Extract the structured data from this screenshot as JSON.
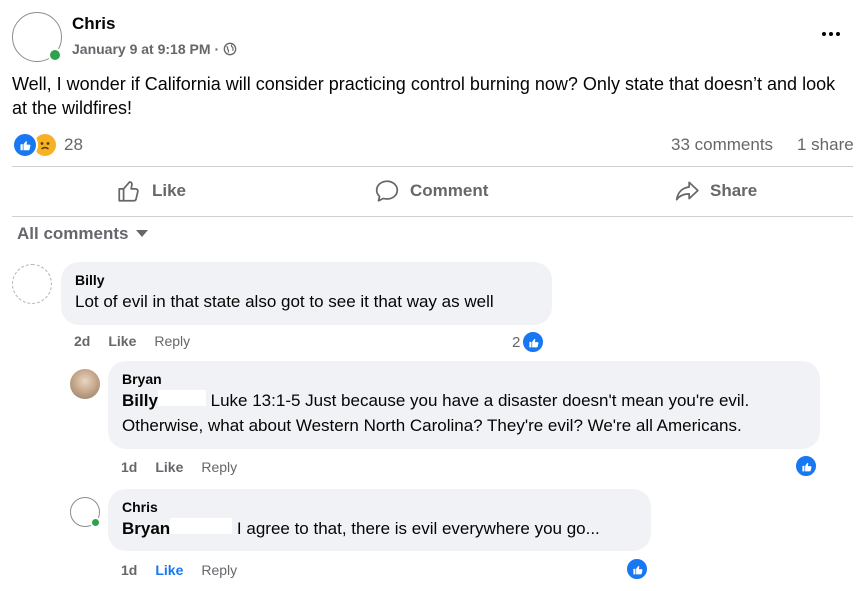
{
  "post": {
    "author": "Chris",
    "date": "January 9 at 9:18 PM",
    "separator": "·",
    "text": "Well, I wonder if California will consider practicing control burning now? Only state that doesn’t and look at the wildfires!",
    "more_icon": "more-dots-icon",
    "privacy_icon": "globe-icon"
  },
  "stats": {
    "reaction_count": "28",
    "comments": "33 comments",
    "shares": "1 share"
  },
  "actions": {
    "like": "Like",
    "comment": "Comment",
    "share": "Share"
  },
  "filter": {
    "label": "All comments"
  },
  "comments": [
    {
      "name": "Billy",
      "text": "Lot of evil in that state also got to see it that way as well",
      "time": "2d",
      "like": "Like",
      "reply": "Reply",
      "like_count": "2"
    },
    {
      "name": "Bryan",
      "mention": "Billy",
      "text_line1": "Luke 13:1-5 Just because you have a disaster doesn't mean you're evil.",
      "text_line2": "Otherwise, what about Western North Carolina? They're evil? We're all Americans.",
      "time": "1d",
      "like": "Like",
      "reply": "Reply"
    },
    {
      "name": "Chris",
      "mention": "Bryan",
      "text": "I agree to that, there is evil everywhere you go...",
      "time": "1d",
      "like": "Like",
      "reply": "Reply"
    }
  ],
  "colors": {
    "accent": "#1877f2",
    "bubble": "#f0f2f5",
    "secondary_text": "#65676b",
    "online": "#31a24c",
    "sad_face": "#f7b125"
  }
}
